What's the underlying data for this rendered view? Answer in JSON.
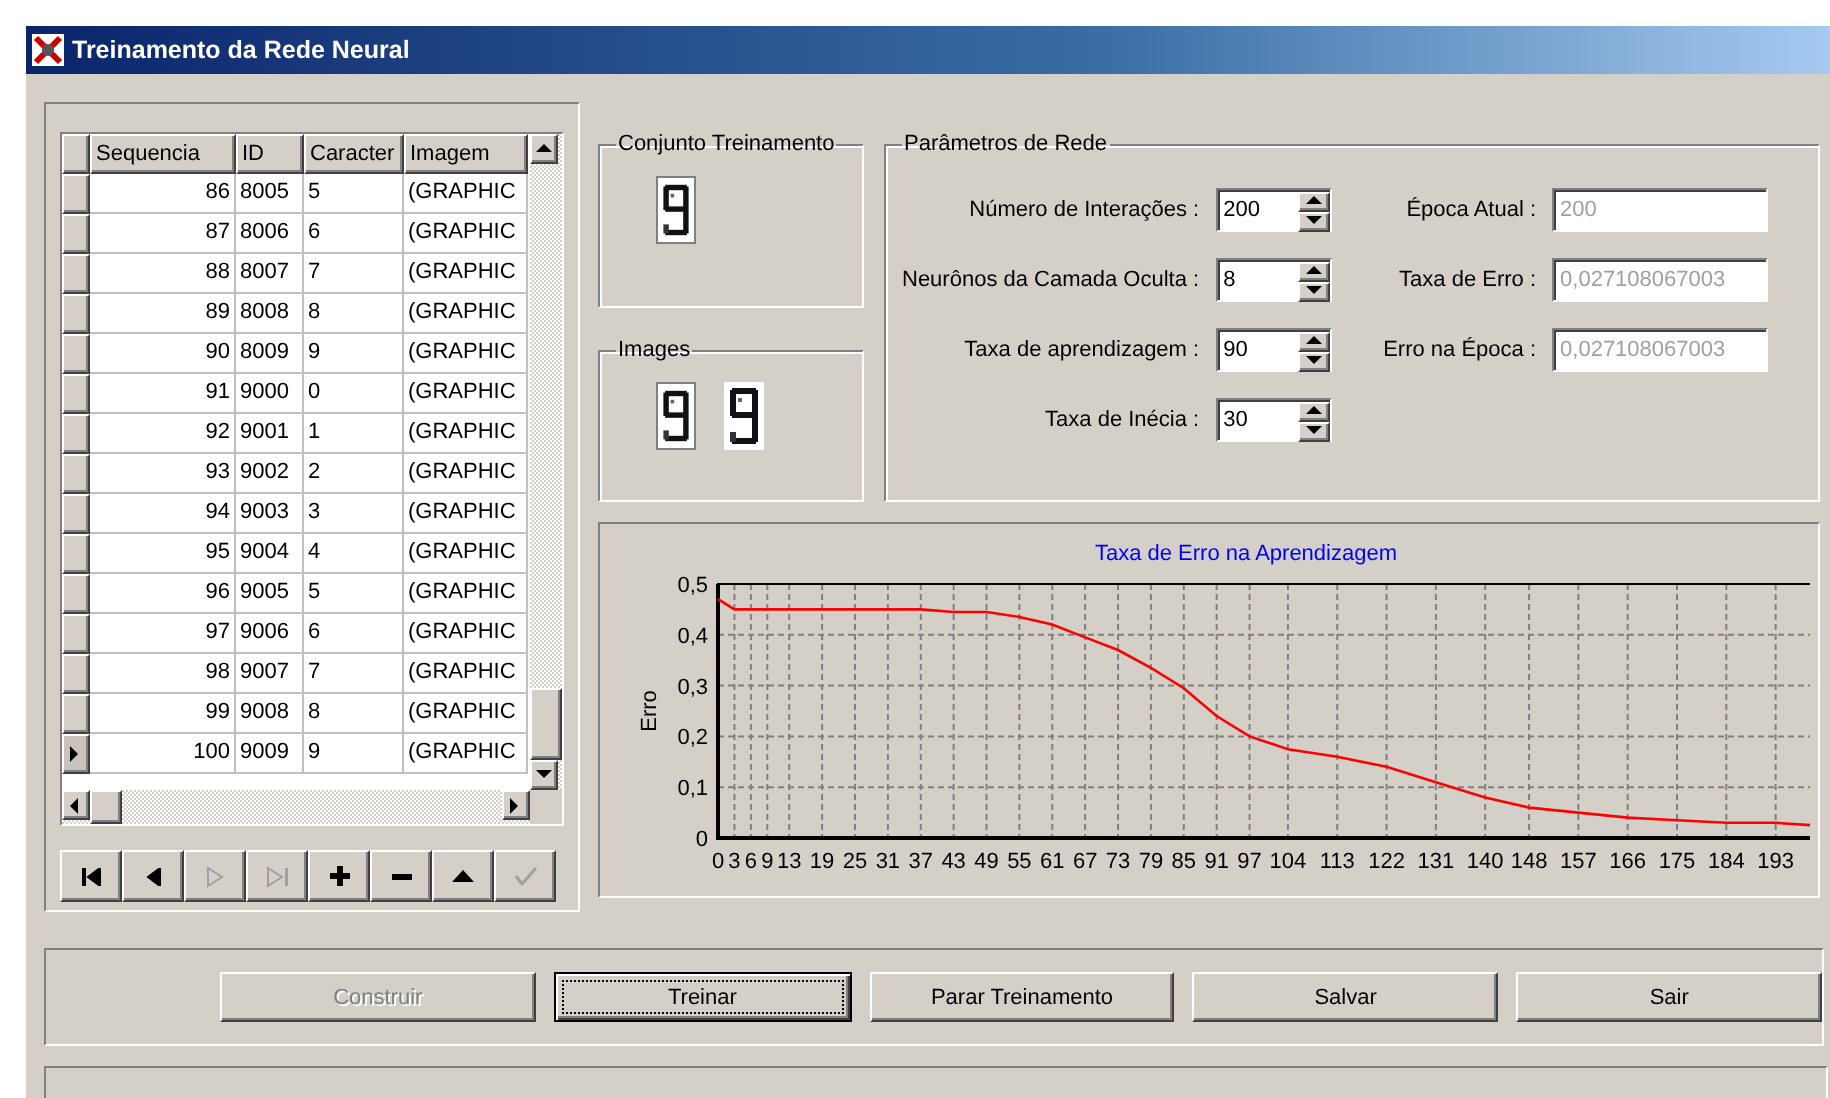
{
  "window": {
    "title": "Treinamento da Rede Neural"
  },
  "grid": {
    "columns": [
      "Sequencia",
      "ID",
      "Caracter",
      "Imagem"
    ],
    "rows": [
      {
        "cells": [
          "86",
          "8005",
          "5",
          "(GRAPHIC"
        ],
        "selected": false
      },
      {
        "cells": [
          "87",
          "8006",
          "6",
          "(GRAPHIC"
        ],
        "selected": false
      },
      {
        "cells": [
          "88",
          "8007",
          "7",
          "(GRAPHIC"
        ],
        "selected": false
      },
      {
        "cells": [
          "89",
          "8008",
          "8",
          "(GRAPHIC"
        ],
        "selected": false
      },
      {
        "cells": [
          "90",
          "8009",
          "9",
          "(GRAPHIC"
        ],
        "selected": false
      },
      {
        "cells": [
          "91",
          "9000",
          "0",
          "(GRAPHIC"
        ],
        "selected": false
      },
      {
        "cells": [
          "92",
          "9001",
          "1",
          "(GRAPHIC"
        ],
        "selected": false
      },
      {
        "cells": [
          "93",
          "9002",
          "2",
          "(GRAPHIC"
        ],
        "selected": false
      },
      {
        "cells": [
          "94",
          "9003",
          "3",
          "(GRAPHIC"
        ],
        "selected": false
      },
      {
        "cells": [
          "95",
          "9004",
          "4",
          "(GRAPHIC"
        ],
        "selected": false
      },
      {
        "cells": [
          "96",
          "9005",
          "5",
          "(GRAPHIC"
        ],
        "selected": false
      },
      {
        "cells": [
          "97",
          "9006",
          "6",
          "(GRAPHIC"
        ],
        "selected": false
      },
      {
        "cells": [
          "98",
          "9007",
          "7",
          "(GRAPHIC"
        ],
        "selected": false
      },
      {
        "cells": [
          "99",
          "9008",
          "8",
          "(GRAPHIC"
        ],
        "selected": false
      },
      {
        "cells": [
          "100",
          "9009",
          "9",
          "(GRAPHIC"
        ],
        "selected": true
      }
    ]
  },
  "navigator": [
    {
      "kind": "first",
      "disabled": false
    },
    {
      "kind": "prior",
      "disabled": false
    },
    {
      "kind": "next",
      "disabled": true
    },
    {
      "kind": "last",
      "disabled": true
    },
    {
      "kind": "insert",
      "disabled": false
    },
    {
      "kind": "delete",
      "disabled": false
    },
    {
      "kind": "edit",
      "disabled": false
    },
    {
      "kind": "post",
      "disabled": true
    }
  ],
  "training_set": {
    "title": "Conjunto Treinamento"
  },
  "images": {
    "title": "Images"
  },
  "parameters": {
    "title": "Parâmetros de Rede",
    "inputs": [
      {
        "label": "Número de Interações :",
        "value": "200"
      },
      {
        "label": "Neurônos da Camada Oculta :",
        "value": "8"
      },
      {
        "label": "Taxa de aprendizagem :",
        "value": "90"
      },
      {
        "label": "Taxa de Inécia :",
        "value": "30"
      }
    ],
    "outputs": [
      {
        "label": "Época Atual :",
        "value": "200",
        "disabled": true
      },
      {
        "label": "Taxa de Erro :",
        "value": "0,027108067003",
        "disabled": true
      },
      {
        "label": "Erro na Época :",
        "value": "0,027108067003",
        "disabled": true
      }
    ]
  },
  "chart": {
    "chart_data": {
      "type": "line",
      "title": "Taxa de Erro na Aprendizagem",
      "ylabel": "Erro",
      "x": [
        0,
        3,
        6,
        9,
        13,
        19,
        25,
        31,
        37,
        43,
        49,
        55,
        61,
        67,
        73,
        79,
        85,
        91,
        97,
        104,
        113,
        122,
        131,
        140,
        148,
        157,
        166,
        175,
        184,
        193,
        200
      ],
      "grid": true,
      "series": [
        {
          "color": "#ff0000",
          "values": [
            0.47,
            0.45,
            0.45,
            0.45,
            0.45,
            0.45,
            0.45,
            0.45,
            0.45,
            0.445,
            0.445,
            0.435,
            0.42,
            0.395,
            0.37,
            0.335,
            0.295,
            0.24,
            0.2,
            0.175,
            0.16,
            0.14,
            0.11,
            0.08,
            0.06,
            0.05,
            0.04,
            0.035,
            0.03,
            0.03,
            0.025
          ]
        }
      ],
      "xlim": [
        0,
        200
      ],
      "ylim": [
        0,
        0.5
      ],
      "xticks": [
        0,
        3,
        6,
        9,
        13,
        19,
        25,
        31,
        37,
        43,
        49,
        55,
        61,
        67,
        73,
        79,
        85,
        91,
        97,
        104,
        113,
        122,
        131,
        140,
        148,
        157,
        166,
        175,
        184,
        193
      ],
      "yticks": [
        {
          "value": 0,
          "label": "0"
        },
        {
          "value": 0.1,
          "label": "0,1"
        },
        {
          "value": 0.2,
          "label": "0,2"
        },
        {
          "value": 0.3,
          "label": "0,3"
        },
        {
          "value": 0.4,
          "label": "0,4"
        },
        {
          "value": 0.5,
          "label": "0,5"
        }
      ]
    }
  },
  "buttons": [
    {
      "label": "Construir",
      "disabled": true,
      "focused": false
    },
    {
      "label": "Treinar",
      "disabled": false,
      "focused": true
    },
    {
      "label": "Parar Treinamento",
      "disabled": false,
      "focused": false
    },
    {
      "label": "Salvar",
      "disabled": false,
      "focused": false
    },
    {
      "label": "Sair",
      "disabled": false,
      "focused": false
    }
  ]
}
